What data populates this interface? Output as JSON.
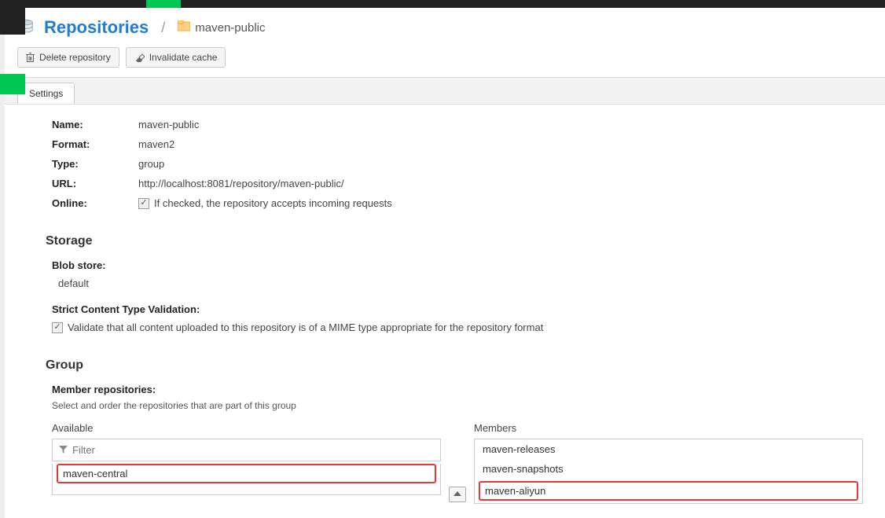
{
  "breadcrumb": {
    "title": "Repositories",
    "current": "maven-public"
  },
  "actions": {
    "delete": "Delete repository",
    "invalidate": "Invalidate cache"
  },
  "tabs": {
    "settings": "Settings"
  },
  "fields": {
    "name_label": "Name:",
    "name_value": "maven-public",
    "format_label": "Format:",
    "format_value": "maven2",
    "type_label": "Type:",
    "type_value": "group",
    "url_label": "URL:",
    "url_value": "http://localhost:8081/repository/maven-public/",
    "online_label": "Online:",
    "online_desc": "If checked, the repository accepts incoming requests"
  },
  "storage": {
    "heading": "Storage",
    "blob_label": "Blob store:",
    "blob_value": "default",
    "strict_label": "Strict Content Type Validation:",
    "strict_desc": "Validate that all content uploaded to this repository is of a MIME type appropriate for the repository format"
  },
  "group": {
    "heading": "Group",
    "member_label": "Member repositories:",
    "member_desc": "Select and order the repositories that are part of this group",
    "available_title": "Available",
    "members_title": "Members",
    "filter_placeholder": "Filter",
    "available_items": [
      "maven-central"
    ],
    "member_items": [
      "maven-releases",
      "maven-snapshots",
      "maven-aliyun"
    ]
  }
}
